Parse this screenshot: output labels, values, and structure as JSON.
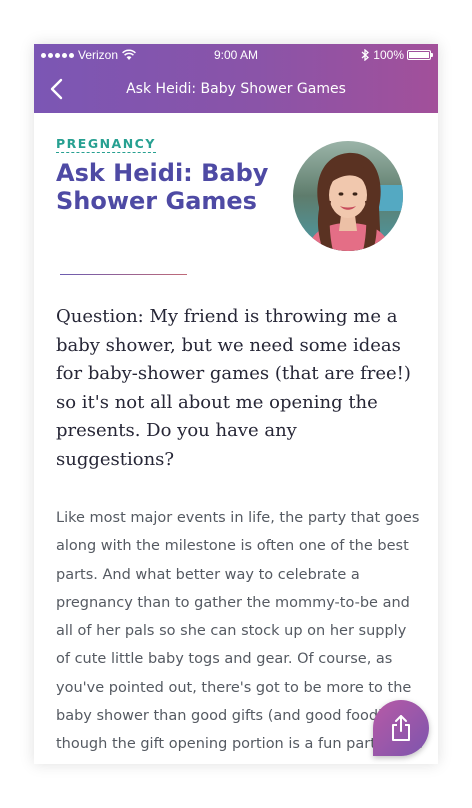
{
  "status": {
    "carrier": "Verizon",
    "time": "9:00 AM",
    "battery": "100%",
    "signal_icon": "signal-dots-icon",
    "wifi_icon": "wifi-icon",
    "bluetooth_icon": "bluetooth-icon",
    "battery_icon": "battery-icon"
  },
  "nav": {
    "title": "Ask Heidi: Baby Shower Games",
    "back_icon": "chevron-left-icon"
  },
  "article": {
    "category": "PREGNANCY",
    "title": "Ask Heidi: Baby Shower Games",
    "question": "Question: My friend is throwing me a baby shower, but we need some ideas for baby-shower games (that are free!) so it's not all about me opening the presents. Do you have any suggestions?",
    "body": "Like most major events in life, the party that goes along with the milestone is often one of the best parts. And what better way to celebrate a pregnancy than to gather the mommy-to-be and all of her pals so she can stock up on her supply of cute little baby togs and gear. Of course, as you've pointed out, there's got to be more to the baby shower than good gifts (and good food) and though the gift opening portion is a fun part of the party, everyone needs something else to do."
  },
  "share": {
    "icon": "share-icon"
  },
  "colors": {
    "accent_purple": "#4e4aa4",
    "category_teal": "#27a091",
    "header_gradient_start": "#7b56b4",
    "header_gradient_end": "#a2509a"
  }
}
